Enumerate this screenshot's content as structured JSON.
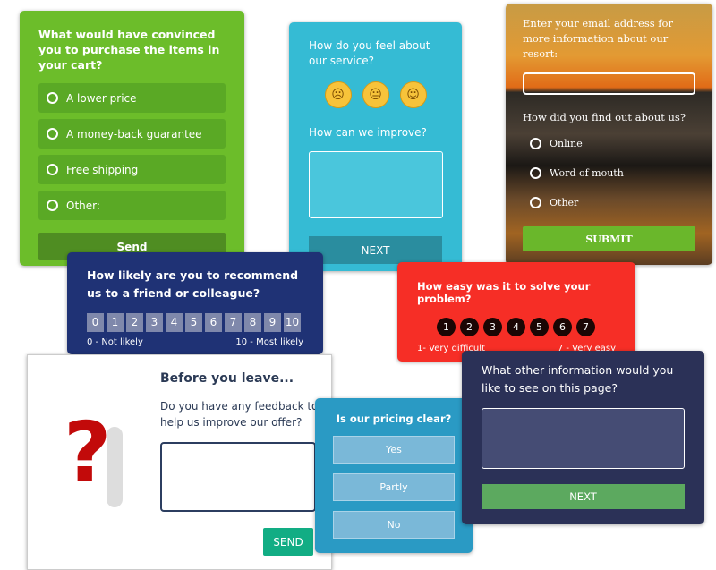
{
  "cart_survey": {
    "question": "What would have convinced you to purchase the items in your cart?",
    "options": [
      "A lower price",
      "A money-back guarantee",
      "Free shipping",
      "Other:"
    ],
    "button": "Send",
    "color": "#6cbd2a"
  },
  "service_survey": {
    "question1": "How do you feel about our service?",
    "emojis": [
      "☹",
      "😐",
      "☺"
    ],
    "question2": "How can we improve?",
    "button": "NEXT",
    "color": "#35bbd4"
  },
  "resort_survey": {
    "email_prompt": "Enter your email address for more information about our resort:",
    "question": "How did you find out about us?",
    "options": [
      "Online",
      "Word of mouth",
      "Other"
    ],
    "button": "SUBMIT"
  },
  "nps_survey": {
    "question": "How likely are you to recommend us to a friend or colleague?",
    "scale": [
      "0",
      "1",
      "2",
      "3",
      "4",
      "5",
      "6",
      "7",
      "8",
      "9",
      "10"
    ],
    "low_label": "0 - Not likely",
    "high_label": "10 - Most likely",
    "color": "#1f3275"
  },
  "effort_survey": {
    "question": "How easy was it to solve your problem?",
    "scale": [
      "1",
      "2",
      "3",
      "4",
      "5",
      "6",
      "7"
    ],
    "low_label": "1- Very difficult",
    "high_label": "7 - Very easy",
    "color": "#f62e26"
  },
  "exit_survey": {
    "title": "Before you leave...",
    "question": "Do you have any feedback to help us improve our offer?",
    "button": "SEND"
  },
  "pricing_survey": {
    "question": "Is our pricing clear?",
    "options": [
      "Yes",
      "Partly",
      "No"
    ]
  },
  "info_survey": {
    "question": "What other information would you like to see on this page?",
    "button": "NEXT"
  }
}
